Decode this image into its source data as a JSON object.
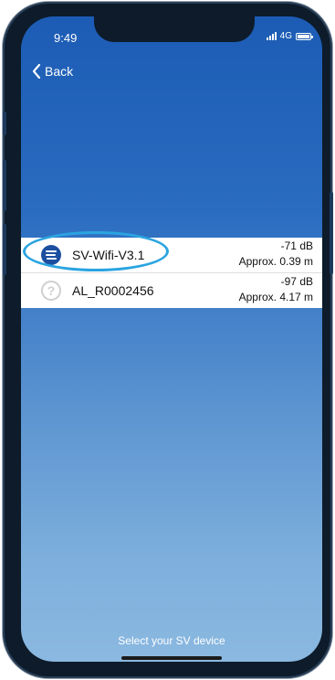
{
  "status_bar": {
    "time": "9:49",
    "network": "4G"
  },
  "nav": {
    "back_label": "Back"
  },
  "devices": [
    {
      "name": "SV-Wifi-V3.1",
      "signal": "-71 dB",
      "distance": "Approx. 0.39 m",
      "icon": "sv-logo-icon",
      "highlighted": true
    },
    {
      "name": "AL_R0002456",
      "signal": "-97 dB",
      "distance": "Approx. 4.17 m",
      "icon": "question-mark-icon",
      "highlighted": false
    }
  ],
  "footer": {
    "hint": "Select your SV device"
  },
  "colors": {
    "screen_top": "#1c5cb5",
    "screen_bottom": "#8ab8e0",
    "highlight": "#2aa4e0",
    "sv_icon": "#1c4fa0"
  }
}
